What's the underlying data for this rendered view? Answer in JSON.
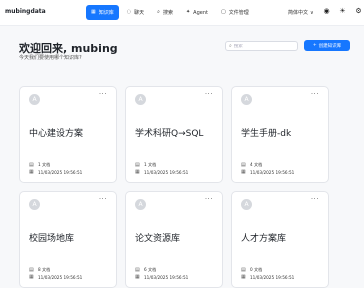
{
  "app": {
    "brand": "mubingdata"
  },
  "nav": [
    {
      "icon": "▦",
      "label": "知识库",
      "active": true
    },
    {
      "icon": "◌",
      "label": "聊天",
      "active": false
    },
    {
      "icon": "⌕",
      "label": "搜索",
      "active": false
    },
    {
      "icon": "✦",
      "label": "Agent",
      "active": false
    },
    {
      "icon": "▢",
      "label": "文件管理",
      "active": false
    }
  ],
  "header_right": {
    "language": "简体中文",
    "language_caret": "∨",
    "github_icon": "◉",
    "theme_icon": "☀",
    "settings_icon": "⚙"
  },
  "main": {
    "welcome": "欢迎回来, mubing",
    "subtitle": "今天我们要使用哪个知识库?",
    "search_placeholder": "搜索",
    "create_button": "创建知识库",
    "create_plus": "+"
  },
  "cards": [
    {
      "avatar": "A",
      "title": "中心建设方案",
      "docs": "1 文档",
      "date": "11/03/2025 19:56:51"
    },
    {
      "avatar": "A",
      "title": "学术科研Q→SQL",
      "docs": "1 文档",
      "date": "11/03/2025 19:56:51"
    },
    {
      "avatar": "A",
      "title": "学生手册-dk",
      "docs": "4 文档",
      "date": "11/03/2025 19:56:51"
    },
    {
      "avatar": "A",
      "title": "校园场地库",
      "docs": "8 文档",
      "date": "11/03/2025 19:56:51"
    },
    {
      "avatar": "A",
      "title": "论文资源库",
      "docs": "6 文档",
      "date": "11/03/2025 19:56:51"
    },
    {
      "avatar": "A",
      "title": "人才方案库",
      "docs": "0 文档",
      "date": "11/03/2025 19:56:51"
    }
  ],
  "colors": {
    "accent": "#1677ff",
    "background": "#f7f8fa"
  }
}
